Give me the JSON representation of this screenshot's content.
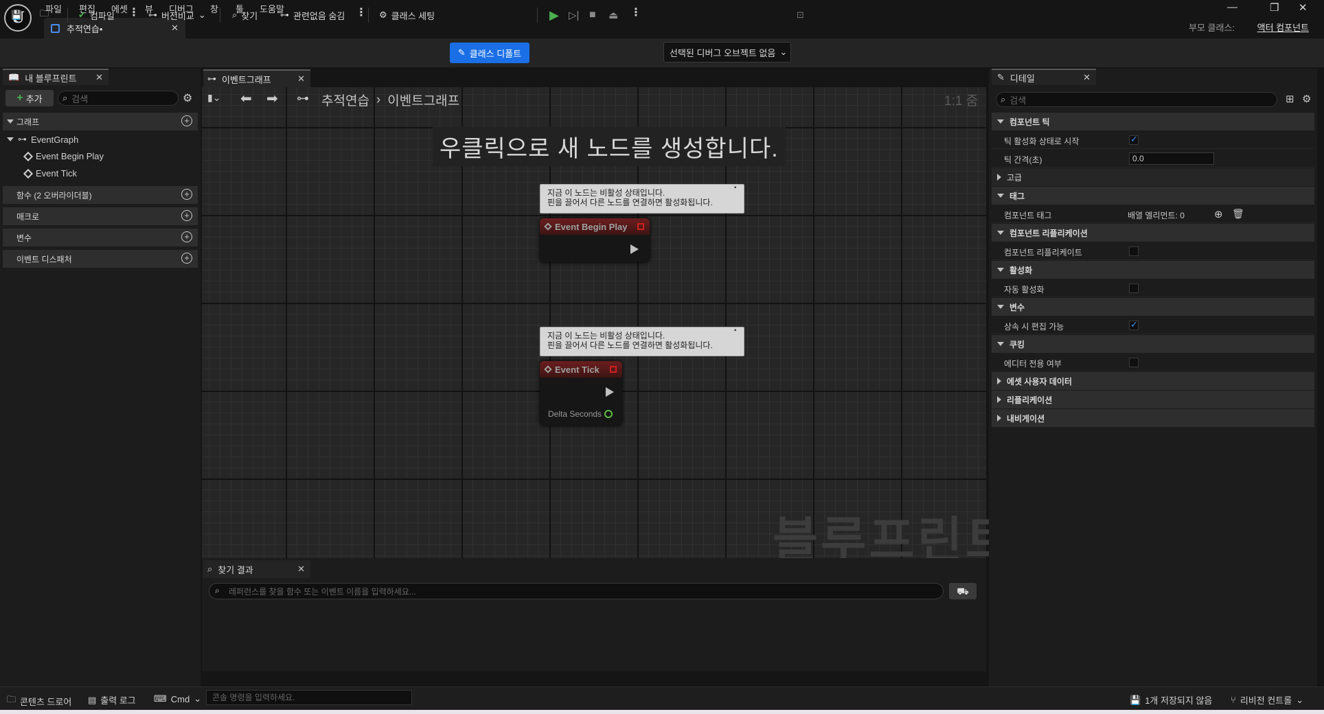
{
  "menu": [
    "파일",
    "편집",
    "에셋",
    "뷰",
    "디버그",
    "창",
    "툴",
    "도움말"
  ],
  "doc_tab": {
    "label": "추적연습•"
  },
  "parent": {
    "label": "부모 클래스:",
    "link": "액터 컴포넌트"
  },
  "toolbar": {
    "compile": "컴파일",
    "diff": "버전비교",
    "find": "찾기",
    "hide_unrelated": "관련없음 숨김",
    "class_settings": "클래스 세팅",
    "class_defaults": "클래스 디폴트",
    "debug_select": "선택된 디버그 오브젝트 없음"
  },
  "my_blueprint": {
    "tab": "내 블루프린트",
    "add": "추가",
    "search_placeholder": "검색",
    "graphs": "그래프",
    "event_graph": "EventGraph",
    "events": [
      "Event Begin Play",
      "Event Tick"
    ],
    "functions": "함수 (2 오버라이더블)",
    "macros": "매크로",
    "variables": "변수",
    "dispatchers": "이벤트 디스패처"
  },
  "graph": {
    "tab": "이벤트그래프",
    "breadcrumb": [
      "추적연습",
      "이벤트그래프"
    ],
    "zoom": "1:1 줌",
    "hint": "우클릭으로 새 노드를 생성합니다.",
    "watermark": "블루프린트",
    "comment_line1": "지금 이 노드는 비활성 상태입니다.",
    "comment_line2": "핀을 끌어서 다른 노드를 연결하면 활성화됩니다.",
    "node1": "Event Begin Play",
    "node2": "Event Tick",
    "pin_delta": "Delta Seconds"
  },
  "find": {
    "tab": "찾기 결과",
    "placeholder": "레퍼런스를 찾을 함수 또는 이벤트 이름을 입력하세요..."
  },
  "details": {
    "tab": "디테일",
    "search_placeholder": "검색",
    "sections": {
      "tick": "컴포넌트 틱",
      "advanced": "고급",
      "tags": "태그",
      "replication": "컴포넌트 리플리케이션",
      "activation": "활성화",
      "variables": "변수",
      "cooking": "쿠킹",
      "asset_user_data": "에셋 사용자 데이터",
      "replication2": "리플리케이션",
      "navigation": "내비게이션"
    },
    "props": {
      "start_tick": "틱 활성화 상태로 시작",
      "tick_interval": "틱 간격(초)",
      "tick_interval_value": "0.0",
      "component_tags": "컴포넌트 태그",
      "array_elements": "배열 엘리먼트: 0",
      "replicates": "컴포넌트 리플리케이트",
      "auto_activate": "자동 활성화",
      "editable_inherit": "상속 시 편집 가능",
      "editor_only": "에디터 전용 여부"
    }
  },
  "statusbar": {
    "content_drawer": "콘텐츠 드로어",
    "output_log": "출력 로그",
    "cmd": "Cmd",
    "cmd_placeholder": "콘솔 명령을 입력하세요.",
    "unsaved": "1개 저장되지 않음",
    "revision": "리비전 컨트롤"
  }
}
